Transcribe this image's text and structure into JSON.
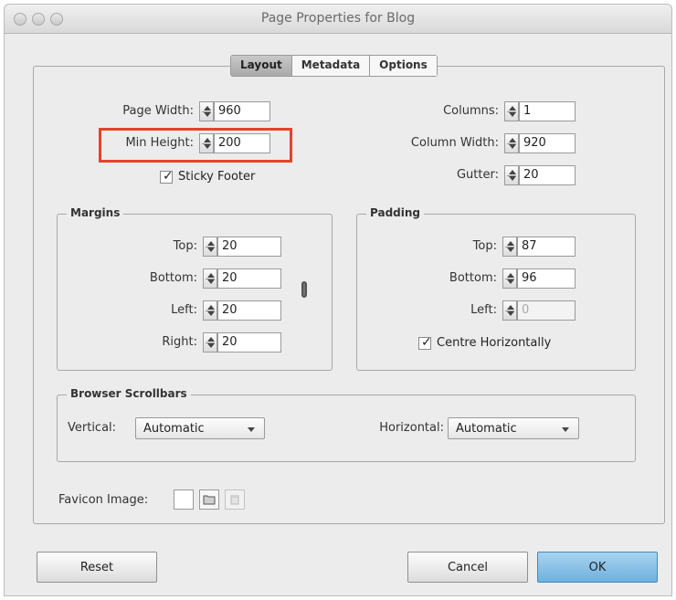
{
  "window": {
    "title": "Page Properties for Blog"
  },
  "tabs": [
    {
      "label": "Layout",
      "active": true
    },
    {
      "label": "Metadata",
      "active": false
    },
    {
      "label": "Options",
      "active": false
    }
  ],
  "layout": {
    "page_width": {
      "label": "Page Width:",
      "value": "960"
    },
    "min_height": {
      "label": "Min Height:",
      "value": "200"
    },
    "sticky_footer": {
      "label": "Sticky Footer",
      "checked": true
    },
    "columns": {
      "label": "Columns:",
      "value": "1"
    },
    "column_width": {
      "label": "Column Width:",
      "value": "920"
    },
    "gutter": {
      "label": "Gutter:",
      "value": "20"
    }
  },
  "margins": {
    "title": "Margins",
    "top": {
      "label": "Top:",
      "value": "20"
    },
    "bottom": {
      "label": "Bottom:",
      "value": "20"
    },
    "left": {
      "label": "Left:",
      "value": "20"
    },
    "right": {
      "label": "Right:",
      "value": "20"
    }
  },
  "padding": {
    "title": "Padding",
    "top": {
      "label": "Top:",
      "value": "87"
    },
    "bottom": {
      "label": "Bottom:",
      "value": "96"
    },
    "left": {
      "label": "Left:",
      "value": "0"
    },
    "centre_horizontally": {
      "label": "Centre Horizontally",
      "checked": true
    }
  },
  "scrollbars": {
    "title": "Browser Scrollbars",
    "vertical": {
      "label": "Vertical:",
      "value": "Automatic"
    },
    "horizontal": {
      "label": "Horizontal:",
      "value": "Automatic"
    }
  },
  "favicon": {
    "label": "Favicon Image:"
  },
  "buttons": {
    "reset": "Reset",
    "cancel": "Cancel",
    "ok": "OK"
  },
  "colors": {
    "highlight": "#e4432c",
    "ok_button": "#6fb0de"
  }
}
